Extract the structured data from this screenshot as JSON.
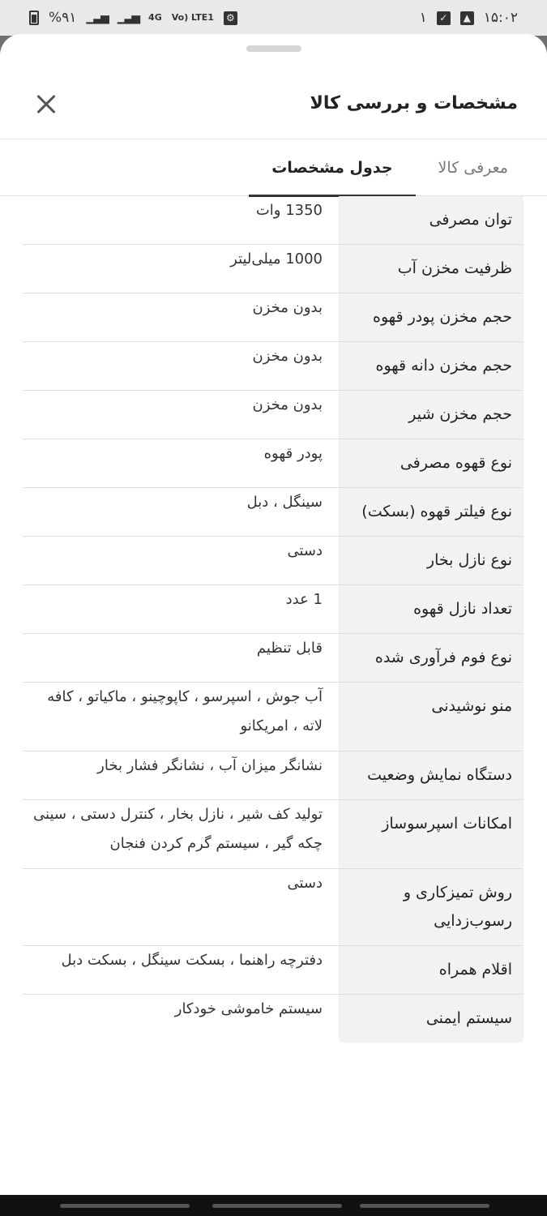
{
  "status_bar": {
    "time": "۱۵:۰۲",
    "notification_count": "۱",
    "battery": "%۹۱",
    "network": "4G",
    "volte": "Vo) LTE1"
  },
  "sheet": {
    "title": "مشخصات و بررسی کالا",
    "tabs": [
      {
        "label": "معرفی کالا",
        "active": false
      },
      {
        "label": "جدول مشخصات",
        "active": true
      }
    ]
  },
  "specs": [
    {
      "key": "توان مصرفی",
      "value": "1350 وات"
    },
    {
      "key": "ظرفیت مخزن آب",
      "value": "1000 میلی‌لیتر"
    },
    {
      "key": "حجم مخزن پودر قهوه",
      "value": "بدون مخزن"
    },
    {
      "key": "حجم مخزن دانه قهوه",
      "value": "بدون مخزن"
    },
    {
      "key": "حجم مخزن شیر",
      "value": "بدون مخزن"
    },
    {
      "key": "نوع قهوه مصرفی",
      "value": "پودر قهوه"
    },
    {
      "key": "نوع فیلتر قهوه (بسکت)",
      "value": "سینگل ، دبل"
    },
    {
      "key": "نوع نازل بخار",
      "value": "دستی"
    },
    {
      "key": "تعداد نازل قهوه",
      "value": "1 عدد"
    },
    {
      "key": "نوع فوم فرآوری شده",
      "value": "قابل تنظیم"
    },
    {
      "key": "منو نوشیدنی",
      "value": "آب جوش ، اسپرسو ، کاپوچینو ، ماکیاتو ، کافه لاته ، امریکانو"
    },
    {
      "key": "دستگاه نمایش وضعیت",
      "value": "نشانگر میزان آب ، نشانگر فشار بخار"
    },
    {
      "key": "امکانات اسپرسوساز",
      "value": "تولید کف شیر ، نازل بخار ، کنترل دستی ، سینی چکه گیر ، سیستم گرم کردن فنجان"
    },
    {
      "key": "روش تمیزکاری و رسوب‌زدایی",
      "value": "دستی"
    },
    {
      "key": "اقلام همراه",
      "value": "دفترچه راهنما ، بسکت سینگل ، بسکت دبل"
    },
    {
      "key": "سیستم ایمنی",
      "value": "سیستم خاموشی خودکار"
    }
  ]
}
